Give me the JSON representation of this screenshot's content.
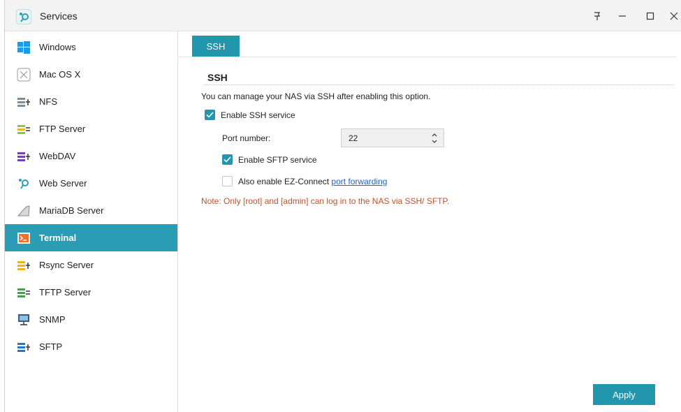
{
  "window": {
    "title": "Services",
    "controls": [
      "pin",
      "minimize",
      "maximize",
      "close"
    ]
  },
  "sidebar": {
    "items": [
      {
        "label": "Windows",
        "icon": "windows-icon"
      },
      {
        "label": "Mac OS X",
        "icon": "macos-icon"
      },
      {
        "label": "NFS",
        "icon": "nfs-icon"
      },
      {
        "label": "FTP Server",
        "icon": "ftp-icon"
      },
      {
        "label": "WebDAV",
        "icon": "webdav-icon"
      },
      {
        "label": "Web Server",
        "icon": "web-server-icon"
      },
      {
        "label": "MariaDB Server",
        "icon": "mariadb-icon"
      },
      {
        "label": "Terminal",
        "icon": "terminal-icon",
        "active": true
      },
      {
        "label": "Rsync Server",
        "icon": "rsync-icon"
      },
      {
        "label": "TFTP Server",
        "icon": "tftp-icon"
      },
      {
        "label": "SNMP",
        "icon": "snmp-icon"
      },
      {
        "label": "SFTP",
        "icon": "sftp-icon"
      }
    ]
  },
  "main": {
    "tab_label": "SSH",
    "section_title": "SSH",
    "description": "You can manage your NAS via SSH after enabling this option.",
    "enable_ssh": {
      "label": "Enable SSH service",
      "checked": true
    },
    "port": {
      "label": "Port number:",
      "value": "22"
    },
    "enable_sftp": {
      "label": "Enable SFTP service",
      "checked": true
    },
    "ez_connect": {
      "label": "Also enable EZ-Connect ",
      "link_text": "port forwarding",
      "checked": false
    },
    "note": "Note: Only [root] and [admin] can log in to the NAS via SSH/ SFTP.",
    "apply_label": "Apply"
  },
  "colors": {
    "accent": "#2196ad",
    "active_item": "#2a9db4",
    "note": "#c0532c",
    "link": "#1a62d6"
  }
}
